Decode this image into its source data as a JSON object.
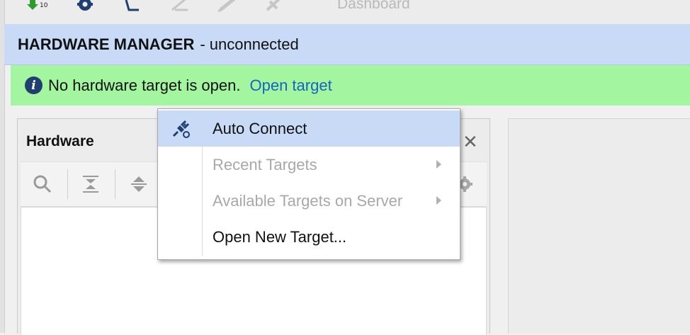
{
  "toolbar": {
    "icons": [
      "run-green-arrow-icon",
      "gear-icon",
      "sigma-icon",
      "disabled-probe-icon",
      "disabled-pencil-icon",
      "disabled-pin-icon"
    ],
    "layout_label": "Dashboard"
  },
  "header": {
    "title": "HARDWARE MANAGER",
    "subtitle": "- unconnected"
  },
  "banner": {
    "icon": "info-icon",
    "message": "No hardware target is open.",
    "link": "Open target",
    "color": "#a4f5a0"
  },
  "hardware_panel": {
    "title": "Hardware",
    "close_symbol": "✕",
    "tools": [
      "search-icon",
      "collapse-all-icon",
      "expand-all-icon",
      "gear-icon"
    ]
  },
  "context_menu": {
    "items": [
      {
        "label": "Auto Connect",
        "icon": "auto-connect-icon",
        "state": "highlighted"
      },
      {
        "label": "Recent Targets",
        "state": "disabled",
        "submenu": true
      },
      {
        "label": "Available Targets on Server",
        "state": "disabled",
        "submenu": true
      },
      {
        "label": "Open New Target...",
        "state": "enabled"
      }
    ]
  },
  "colors": {
    "header_bg": "#c8daf6",
    "highlight": "#c8daf6",
    "link": "#1565c0"
  }
}
